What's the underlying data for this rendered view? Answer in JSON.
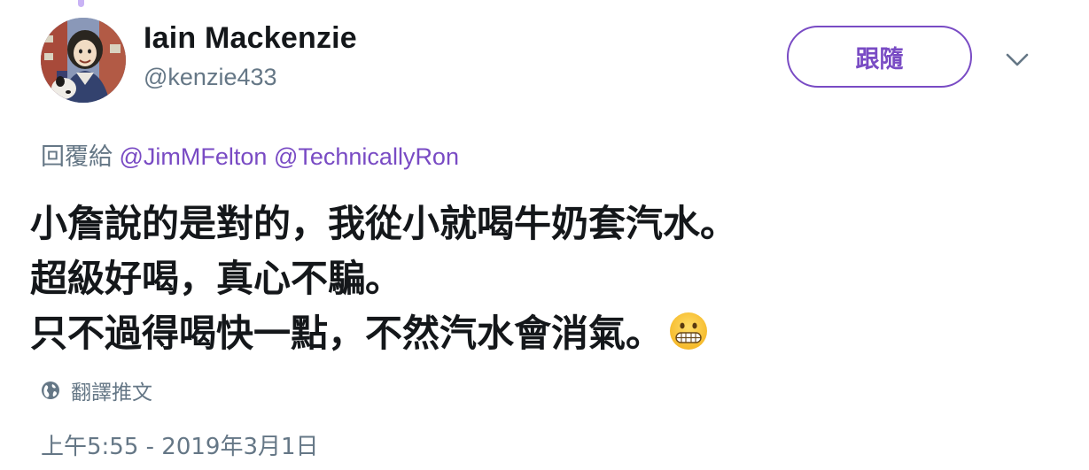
{
  "user": {
    "display_name": "Iain Mackenzie",
    "handle": "@kenzie433"
  },
  "follow_button": {
    "label": "跟隨"
  },
  "reply_context": {
    "prefix": "回覆給",
    "mentions": [
      "@JimMFelton",
      "@TechnicallyRon"
    ]
  },
  "tweet": {
    "lines": [
      "小詹說的是對的，我從小就喝牛奶套汽水。",
      "超級好喝，真心不騙。",
      "只不過得喝快一點，不然汽水會消氣。"
    ]
  },
  "translate": {
    "label": "翻譯推文"
  },
  "timestamp": "上午5:55 - 2019年3月1日",
  "icons": {
    "menu": "chevron-down-icon",
    "translate": "globe-icon",
    "emoji": "grimacing-face-emoji"
  },
  "colors": {
    "accent": "#794bc4",
    "secondary_text": "#657786",
    "primary_text": "#14171a"
  }
}
